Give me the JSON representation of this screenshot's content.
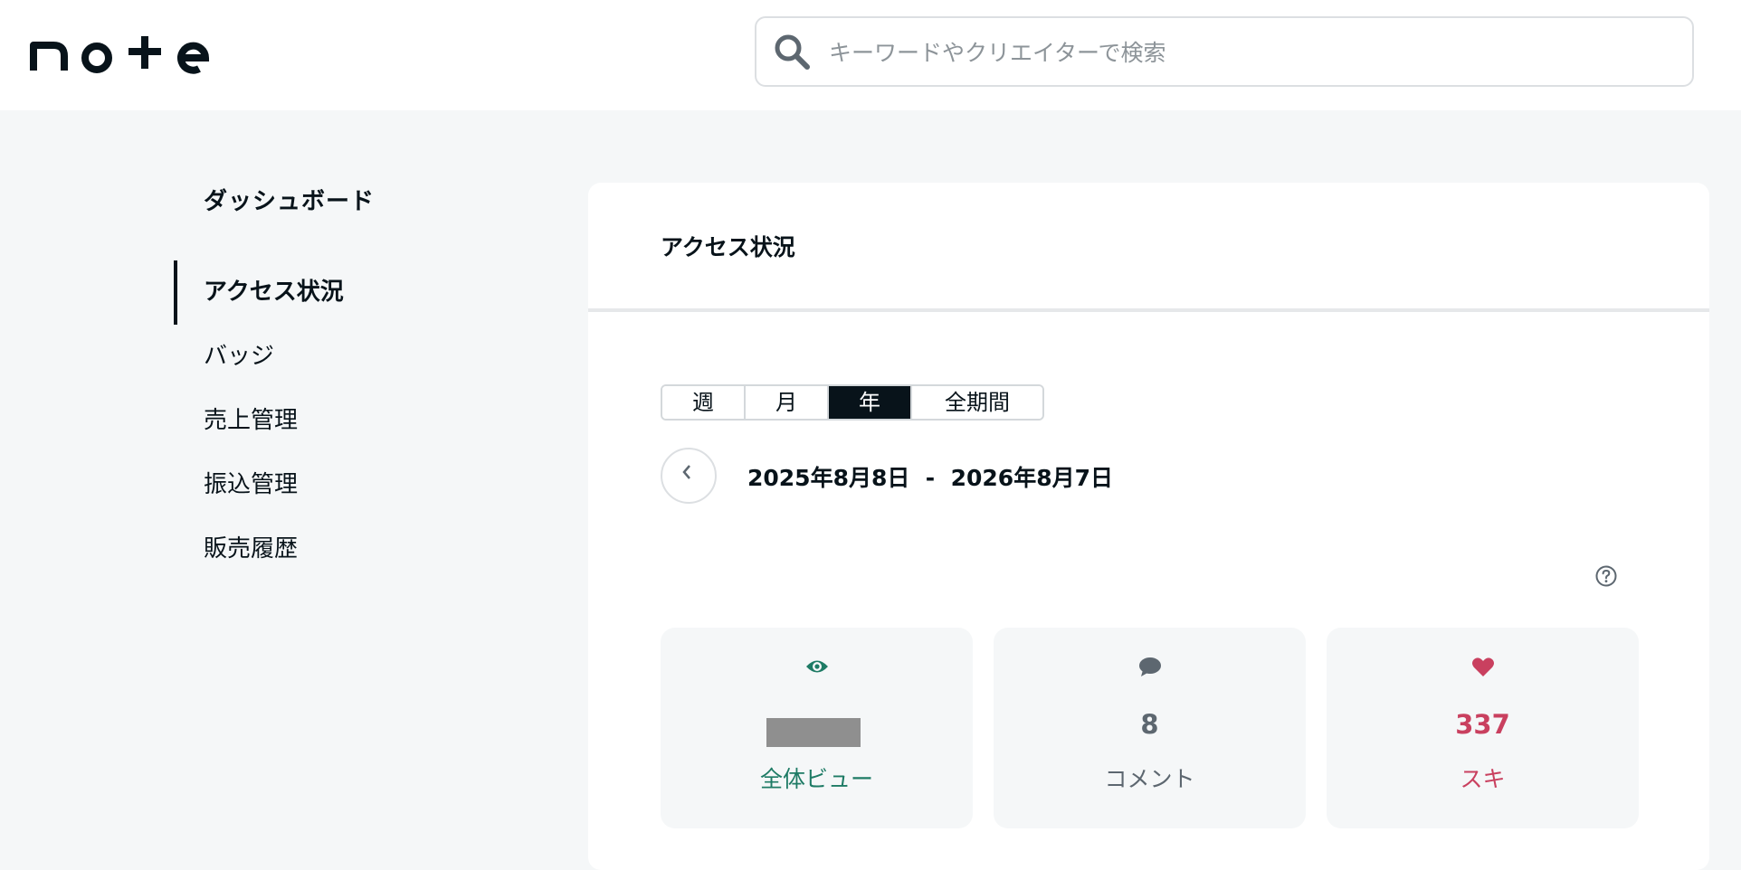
{
  "header": {
    "logo_text": "note",
    "search": {
      "placeholder": "キーワードやクリエイターで検索",
      "icon": "search-icon"
    }
  },
  "sidebar": {
    "title": "ダッシュボード",
    "items": [
      {
        "label": "アクセス状況",
        "active": true
      },
      {
        "label": "バッジ"
      },
      {
        "label": "売上管理"
      },
      {
        "label": "振込管理"
      },
      {
        "label": "販売履歴"
      }
    ]
  },
  "main": {
    "title": "アクセス状況",
    "period_tabs": [
      "週",
      "月",
      "年",
      "全期間"
    ],
    "selected_period": "年",
    "date_range": {
      "start": "2025年8月8日",
      "separator": "-",
      "end": "2026年8月7日"
    },
    "stats": [
      {
        "icon": "eye-icon",
        "value": "",
        "value_redacted": true,
        "label": "全体ビュー",
        "color": "#1e7b65"
      },
      {
        "icon": "comment-icon",
        "value": "8",
        "label": "コメント",
        "color": "#5d6770"
      },
      {
        "icon": "heart-icon",
        "value": "337",
        "label": "スキ",
        "color": "#c9405f"
      }
    ]
  },
  "colors": {
    "background": "#f5f7f8",
    "text": "#08131a",
    "views_green": "#1e7b65",
    "comments_gray": "#5d6770",
    "likes_red": "#c9405f"
  }
}
